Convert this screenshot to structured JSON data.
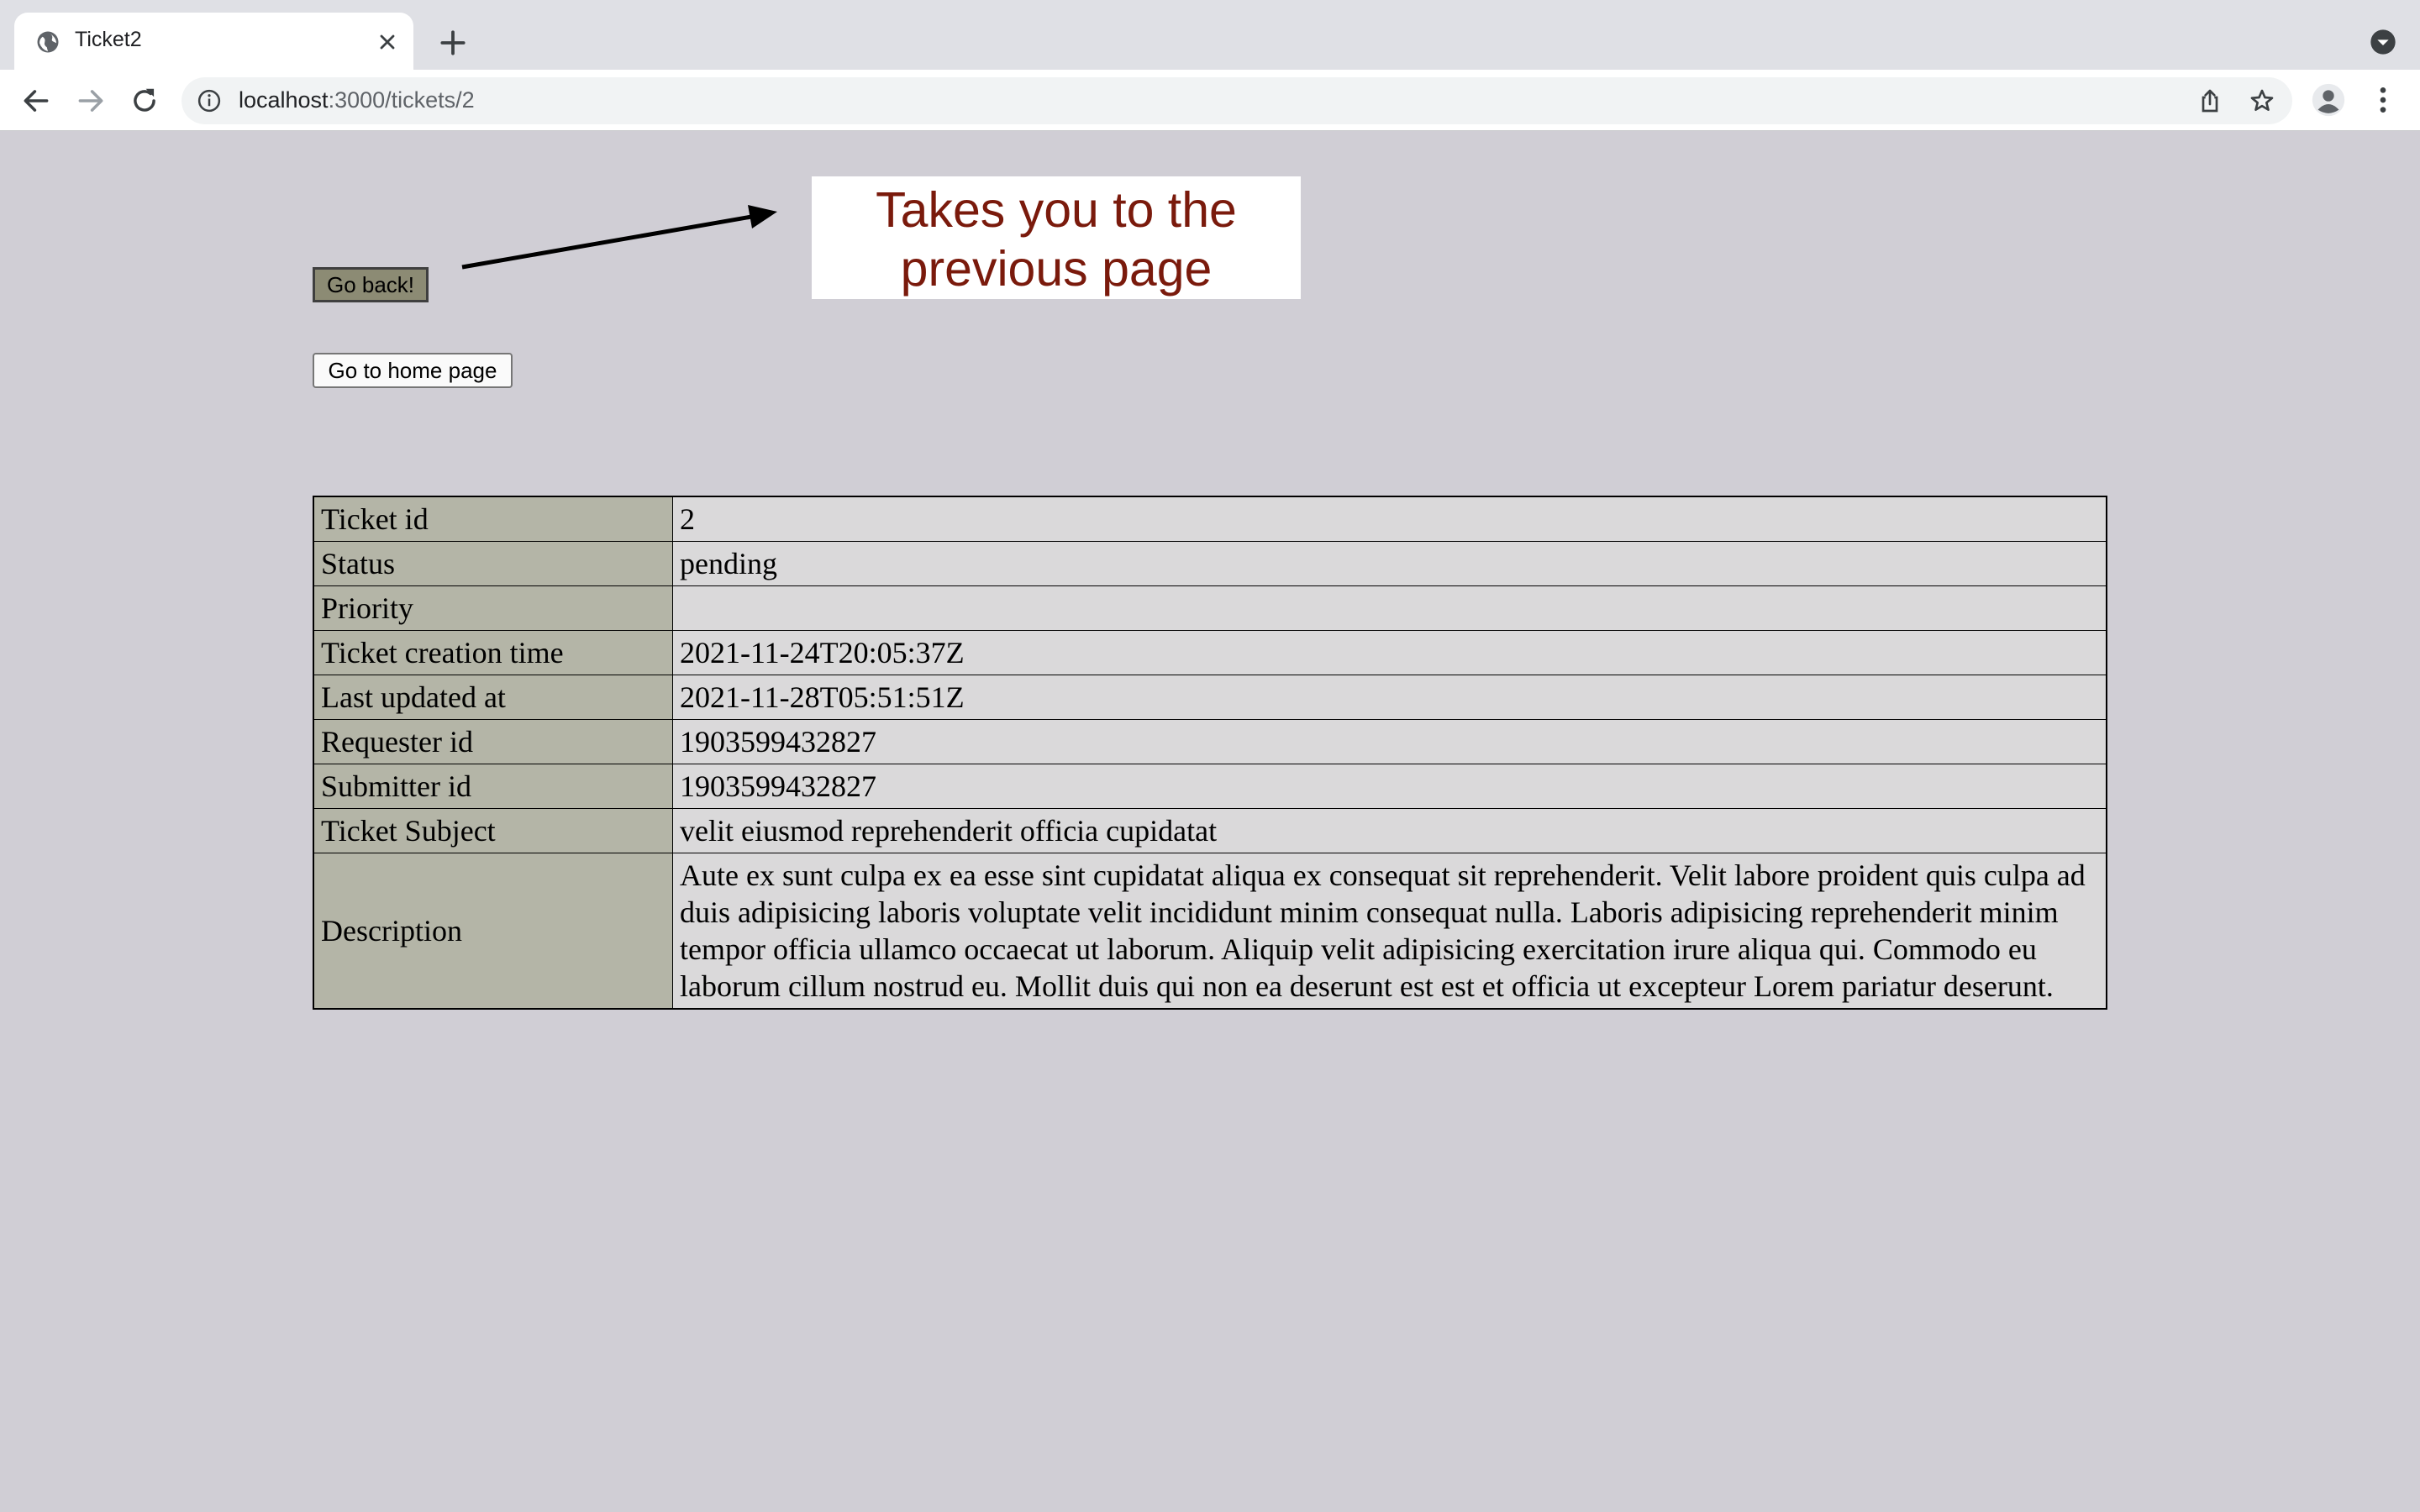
{
  "browser": {
    "tab_title": "Ticket2",
    "url_host": "localhost",
    "url_path": ":3000/tickets/2",
    "icons": [
      "globe-icon",
      "close-icon",
      "plus-icon",
      "chevron-down-icon",
      "back-arrow-icon",
      "forward-arrow-icon",
      "reload-icon",
      "info-icon",
      "share-icon",
      "star-icon",
      "profile-icon",
      "kebab-menu-icon"
    ]
  },
  "page": {
    "go_back_label": "Go back!",
    "go_home_label": "Go to home page",
    "callout_line1": "Takes you to the",
    "callout_line2": "previous page",
    "colors": {
      "background": "#d0ced5",
      "key_cell": "#b4b5a7",
      "value_cell": "#dad9da",
      "back_button": "#8c8b74",
      "callout_text": "#7a1a0c"
    }
  },
  "ticket": {
    "rows": [
      {
        "label": "Ticket id",
        "value": "2"
      },
      {
        "label": "Status",
        "value": "pending"
      },
      {
        "label": "Priority",
        "value": ""
      },
      {
        "label": "Ticket creation time",
        "value": "2021-11-24T20:05:37Z"
      },
      {
        "label": "Last updated at",
        "value": "2021-11-28T05:51:51Z"
      },
      {
        "label": "Requester id",
        "value": "1903599432827"
      },
      {
        "label": "Submitter id",
        "value": "1903599432827"
      },
      {
        "label": "Ticket Subject",
        "value": "velit eiusmod reprehenderit officia cupidatat"
      },
      {
        "label": "Description",
        "value": "Aute ex sunt culpa ex ea esse sint cupidatat aliqua ex consequat sit reprehenderit. Velit labore proident quis culpa ad duis adipisicing laboris voluptate velit incididunt minim consequat nulla. Laboris adipisicing reprehenderit minim tempor officia ullamco occaecat ut laborum. Aliquip velit adipisicing exercitation irure aliqua qui. Commodo eu laborum cillum nostrud eu. Mollit duis qui non ea deserunt est est et officia ut excepteur Lorem pariatur deserunt."
      }
    ]
  }
}
